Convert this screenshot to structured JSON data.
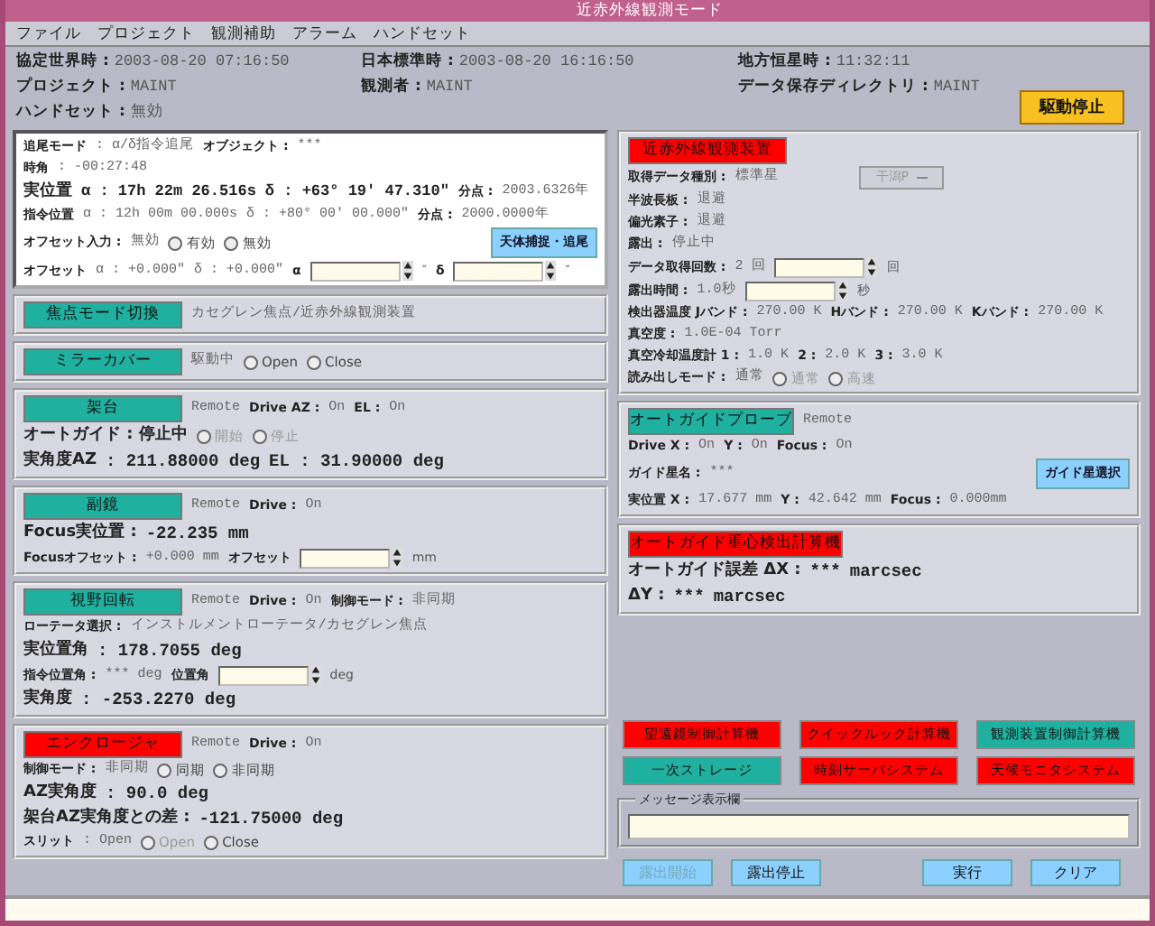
{
  "window": {
    "title": "近赤外線観測モード"
  },
  "menu": [
    "ファイル",
    "プロジェクト",
    "観測補助",
    "アラーム",
    "ハンドセット"
  ],
  "header": {
    "items": [
      {
        "label": "協定世界時 :",
        "value": "2003-08-20 07:16:50"
      },
      {
        "label": "日本標準時 :",
        "value": "2003-08-20 16:16:50"
      },
      {
        "label": "地方恒星時 :",
        "value": "11:32:11"
      },
      {
        "label": "プロジェクト :",
        "value": "MAINT"
      },
      {
        "label": "観測者 :",
        "value": "MAINT"
      },
      {
        "label": "データ保存ディレクトリ :",
        "value": "MAINT"
      },
      {
        "label": "ハンドセット :",
        "value": "無効"
      }
    ],
    "stop_button": "駆動停止"
  },
  "columns": [
    {
      "panels": [
        {
          "kind": "white",
          "rows": [
            {
              "items": [
                {
                  "kind": "label",
                  "caption": "追尾モード"
                },
                {
                  "kind": "value",
                  "text": ": α/δ指令追尾"
                },
                {
                  "kind": "label",
                  "caption": "オブジェクト :"
                },
                {
                  "kind": "value",
                  "text": "***"
                }
              ]
            },
            {
              "items": [
                {
                  "kind": "label",
                  "caption": "時角"
                },
                {
                  "kind": "value",
                  "text": ": -00:27:48"
                }
              ]
            },
            {
              "items": [
                {
                  "kind": "heading",
                  "caption": "実位置"
                },
                {
                  "kind": "reading",
                  "reading": "α : 17h 22m 26.516s"
                },
                {
                  "kind": "reading",
                  "reading": "δ : +63° 19′ 47.310″"
                },
                {
                  "kind": "label",
                  "caption": "分点 :"
                },
                {
                  "kind": "value",
                  "text": "2003.6326年"
                }
              ]
            },
            {
              "items": [
                {
                  "kind": "label",
                  "caption": "指令位置"
                },
                {
                  "kind": "value",
                  "text": "α : 12h 00m 00.000s"
                },
                {
                  "kind": "value",
                  "text": "δ : +80° 00′ 00.000″"
                },
                {
                  "kind": "label",
                  "caption": "分点 :"
                },
                {
                  "kind": "value",
                  "text": "2000.0000年"
                }
              ]
            },
            {
              "items": [
                {
                  "kind": "label",
                  "caption": "オフセット入力 :"
                },
                {
                  "kind": "value",
                  "text": "無効"
                },
                {
                  "kind": "radio",
                  "text": "有効",
                  "selected": false,
                  "disabled": false
                },
                {
                  "kind": "radio",
                  "text": "無効",
                  "selected": false,
                  "disabled": false
                },
                {
                  "kind": "button",
                  "caption": "天体捕捉・追尾",
                  "disabled": false
                }
              ]
            },
            {
              "items": [
                {
                  "kind": "label",
                  "caption": "オフセット"
                },
                {
                  "kind": "value",
                  "text": "α : +0.000″"
                },
                {
                  "kind": "value",
                  "text": "δ : +0.000″"
                },
                {
                  "kind": "label",
                  "caption": "α"
                },
                {
                  "kind": "field"
                },
                {
                  "kind": "unit",
                  "text": "″"
                },
                {
                  "kind": "label",
                  "caption": "δ"
                },
                {
                  "kind": "field"
                },
                {
                  "kind": "unit",
                  "text": "″"
                }
              ]
            }
          ]
        },
        {
          "kind": "framed",
          "rows": [
            {
              "items": [
                {
                  "kind": "tag",
                  "text": "焦点モード切換",
                  "color": "#20b0a0"
                },
                {
                  "kind": "value",
                  "text": "カセグレン焦点/近赤外線観測装置"
                }
              ]
            }
          ]
        },
        {
          "kind": "framed",
          "rows": [
            {
              "items": [
                {
                  "kind": "tag",
                  "text": "ミラーカバー",
                  "color": "#20b0a0"
                },
                {
                  "kind": "value",
                  "text": "駆動中"
                },
                {
                  "kind": "radio",
                  "text": "Open",
                  "selected": false,
                  "disabled": false
                },
                {
                  "kind": "radio",
                  "text": "Close",
                  "selected": false,
                  "disabled": false
                }
              ]
            }
          ]
        },
        {
          "kind": "framed",
          "rows": [
            {
              "items": [
                {
                  "kind": "tag",
                  "text": "架台",
                  "color": "#20b0a0"
                },
                {
                  "kind": "value",
                  "text": "Remote"
                },
                {
                  "kind": "label",
                  "caption": "Drive AZ :"
                },
                {
                  "kind": "value",
                  "text": "On"
                },
                {
                  "kind": "label",
                  "caption": "EL :"
                },
                {
                  "kind": "value",
                  "text": "On"
                }
              ]
            },
            {
              "items": [
                {
                  "kind": "heading",
                  "caption": "オートガイド : 停止中"
                },
                {
                  "kind": "radio",
                  "text": "開始",
                  "selected": false,
                  "disabled": true
                },
                {
                  "kind": "radio",
                  "text": "停止",
                  "selected": false,
                  "disabled": true
                }
              ]
            },
            {
              "items": [
                {
                  "kind": "heading",
                  "caption": "実角度AZ"
                },
                {
                  "kind": "reading",
                  "reading": ": 211.88000 deg"
                },
                {
                  "kind": "reading",
                  "reading": "EL : 31.90000 deg"
                }
              ]
            }
          ]
        },
        {
          "kind": "framed",
          "rows": [
            {
              "items": [
                {
                  "kind": "tag",
                  "text": "副鏡",
                  "color": "#20b0a0"
                },
                {
                  "kind": "value",
                  "text": "Remote"
                },
                {
                  "kind": "label",
                  "caption": "Drive :"
                },
                {
                  "kind": "value",
                  "text": "On"
                }
              ]
            },
            {
              "items": [
                {
                  "kind": "heading",
                  "caption": "Focus実位置 :"
                },
                {
                  "kind": "reading",
                  "reading": "-22.235 mm"
                }
              ]
            },
            {
              "items": [
                {
                  "kind": "label",
                  "caption": "Focusオフセット :"
                },
                {
                  "kind": "value",
                  "text": "+0.000 mm"
                },
                {
                  "kind": "label",
                  "caption": "オフセット"
                },
                {
                  "kind": "field"
                },
                {
                  "kind": "unit",
                  "text": "mm"
                }
              ]
            }
          ]
        },
        {
          "kind": "framed",
          "rows": [
            {
              "items": [
                {
                  "kind": "tag",
                  "text": "視野回転",
                  "color": "#20b0a0"
                },
                {
                  "kind": "value",
                  "text": "Remote"
                },
                {
                  "kind": "label",
                  "caption": "Drive :"
                },
                {
                  "kind": "value",
                  "text": "On"
                },
                {
                  "kind": "label",
                  "caption": "制御モード :"
                },
                {
                  "kind": "value",
                  "text": "非同期"
                }
              ]
            },
            {
              "items": [
                {
                  "kind": "label",
                  "caption": "ローテータ選択 :"
                },
                {
                  "kind": "value",
                  "text": "インストルメントローテータ/カセグレン焦点"
                }
              ]
            },
            {
              "items": [
                {
                  "kind": "heading",
                  "caption": "実位置角"
                },
                {
                  "kind": "reading",
                  "reading": ": 178.7055 deg"
                }
              ]
            },
            {
              "items": [
                {
                  "kind": "label",
                  "caption": "指令位置角 :"
                },
                {
                  "kind": "value",
                  "text": "*** deg"
                },
                {
                  "kind": "label",
                  "caption": "位置角"
                },
                {
                  "kind": "field"
                },
                {
                  "kind": "unit",
                  "text": "deg"
                }
              ]
            },
            {
              "items": [
                {
                  "kind": "heading",
                  "caption": "実角度"
                },
                {
                  "kind": "reading",
                  "reading": ": -253.2270 deg"
                }
              ]
            }
          ]
        },
        {
          "kind": "framed",
          "rows": [
            {
              "items": [
                {
                  "kind": "tag",
                  "text": "エンクロージャ",
                  "color": "#ff0000"
                },
                {
                  "kind": "value",
                  "text": "Remote"
                },
                {
                  "kind": "label",
                  "caption": "Drive :"
                },
                {
                  "kind": "value",
                  "text": "On"
                }
              ]
            },
            {
              "items": [
                {
                  "kind": "label",
                  "caption": "制御モード :"
                },
                {
                  "kind": "value",
                  "text": "非同期"
                },
                {
                  "kind": "radio",
                  "text": "同期",
                  "selected": false,
                  "disabled": false
                },
                {
                  "kind": "radio",
                  "text": "非同期",
                  "selected": false,
                  "disabled": false
                }
              ]
            },
            {
              "items": [
                {
                  "kind": "heading",
                  "caption": "AZ実角度"
                },
                {
                  "kind": "reading",
                  "reading": ": 90.0 deg"
                }
              ]
            },
            {
              "items": [
                {
                  "kind": "heading",
                  "caption": "架台AZ実角度との差 :"
                },
                {
                  "kind": "reading",
                  "reading": "-121.75000 deg"
                }
              ]
            },
            {
              "items": [
                {
                  "kind": "label",
                  "caption": "スリット"
                },
                {
                  "kind": "value",
                  "text": ": Open"
                },
                {
                  "kind": "radio",
                  "text": "Open",
                  "selected": false,
                  "disabled": true
                },
                {
                  "kind": "radio",
                  "text": "Close",
                  "selected": false,
                  "disabled": false
                }
              ]
            }
          ]
        }
      ]
    },
    {
      "panels": [
        {
          "kind": "framed",
          "rows": [
            {
              "items": [
                {
                  "kind": "tag",
                  "text": "近赤外線観測装置",
                  "color": "#ff0000"
                }
              ]
            },
            {
              "items": [
                {
                  "kind": "label",
                  "caption": "取得データ種別 :"
                },
                {
                  "kind": "value",
                  "text": "標準星"
                },
                {
                  "kind": "dropdown",
                  "text": "干潟P",
                  "disabled": true
                }
              ]
            },
            {
              "items": [
                {
                  "kind": "label",
                  "caption": "半波長板 :"
                },
                {
                  "kind": "value",
                  "text": "退避"
                }
              ]
            },
            {
              "items": [
                {
                  "kind": "label",
                  "caption": "偏光素子 :"
                },
                {
                  "kind": "value",
                  "text": "退避"
                }
              ]
            },
            {
              "items": [
                {
                  "kind": "label",
                  "caption": "露出 :"
                },
                {
                  "kind": "value",
                  "text": "停止中"
                }
              ]
            },
            {
              "items": [
                {
                  "kind": "label",
                  "caption": "データ取得回数 :"
                },
                {
                  "kind": "value",
                  "text": "2 回"
                },
                {
                  "kind": "field"
                },
                {
                  "kind": "unit",
                  "text": "回"
                }
              ]
            },
            {
              "items": [
                {
                  "kind": "label",
                  "caption": "露出時間 :"
                },
                {
                  "kind": "value",
                  "text": "1.0秒"
                },
                {
                  "kind": "field"
                },
                {
                  "kind": "unit",
                  "text": "秒"
                }
              ]
            },
            {
              "items": [
                {
                  "kind": "label",
                  "caption": "検出器温度 Jバンド :"
                },
                {
                  "kind": "value",
                  "text": "270.00 K"
                },
                {
                  "kind": "label",
                  "caption": "Hバンド :"
                },
                {
                  "kind": "value",
                  "text": "270.00 K"
                },
                {
                  "kind": "label",
                  "caption": "Kバンド :"
                },
                {
                  "kind": "value",
                  "text": "270.00 K"
                }
              ]
            },
            {
              "items": [
                {
                  "kind": "label",
                  "caption": "真空度 :"
                },
                {
                  "kind": "value",
                  "text": "1.0E-04 Torr"
                }
              ]
            },
            {
              "items": [
                {
                  "kind": "label",
                  "caption": "真空冷却温度計 1 :"
                },
                {
                  "kind": "value",
                  "text": "1.0 K"
                },
                {
                  "kind": "label",
                  "caption": "2 :"
                },
                {
                  "kind": "value",
                  "text": "2.0 K"
                },
                {
                  "kind": "label",
                  "caption": "3 :"
                },
                {
                  "kind": "value",
                  "text": "3.0 K"
                }
              ]
            },
            {
              "items": [
                {
                  "kind": "label",
                  "caption": "読み出しモード :"
                },
                {
                  "kind": "value",
                  "text": "通常"
                },
                {
                  "kind": "radio",
                  "text": "通常",
                  "selected": false,
                  "disabled": true
                },
                {
                  "kind": "radio",
                  "text": "高速",
                  "selected": false,
                  "disabled": true
                }
              ]
            }
          ]
        },
        {
          "kind": "framed",
          "rows": [
            {
              "items": [
                {
                  "kind": "tag",
                  "text": "オートガイドプローブ",
                  "color": "#20b0a0"
                },
                {
                  "kind": "value",
                  "text": "Remote"
                }
              ]
            },
            {
              "items": [
                {
                  "kind": "label",
                  "caption": "Drive X :"
                },
                {
                  "kind": "value",
                  "text": "On"
                },
                {
                  "kind": "label",
                  "caption": "Y :"
                },
                {
                  "kind": "value",
                  "text": "On"
                },
                {
                  "kind": "label",
                  "caption": "Focus :"
                },
                {
                  "kind": "value",
                  "text": "On"
                }
              ]
            },
            {
              "items": [
                {
                  "kind": "label",
                  "caption": "ガイド星名 :"
                },
                {
                  "kind": "value",
                  "text": "***"
                },
                {
                  "kind": "button",
                  "caption": "ガイド星選択",
                  "disabled": false
                }
              ]
            },
            {
              "items": [
                {
                  "kind": "label",
                  "caption": "実位置 X :"
                },
                {
                  "kind": "value",
                  "text": "17.677 mm"
                },
                {
                  "kind": "label",
                  "caption": "Y :"
                },
                {
                  "kind": "value",
                  "text": "42.642 mm"
                },
                {
                  "kind": "label",
                  "caption": "Focus :"
                },
                {
                  "kind": "value",
                  "text": "0.000mm"
                }
              ]
            }
          ]
        },
        {
          "kind": "framed",
          "rows": [
            {
              "items": [
                {
                  "kind": "tag",
                  "text": "オートガイド重心検出計算機",
                  "color": "#ff0000"
                }
              ]
            },
            {
              "items": [
                {
                  "kind": "heading",
                  "caption": "オートガイド誤差 ΔX :"
                },
                {
                  "kind": "reading",
                  "reading": "***"
                },
                {
                  "kind": "reading",
                  "reading": "marcsec"
                }
              ]
            },
            {
              "items": [
                {
                  "kind": "heading",
                  "caption": "ΔY :"
                },
                {
                  "kind": "reading",
                  "reading": "***"
                },
                {
                  "kind": "reading",
                  "reading": "marcsec"
                }
              ]
            }
          ]
        }
      ]
    }
  ],
  "systems": [
    {
      "text": "望遠鏡制御計算機",
      "color": "#ff0000"
    },
    {
      "text": "クイックルック計算機",
      "color": "#ff0000"
    },
    {
      "text": "観測装置制御計算機",
      "color": "#20b0a0"
    },
    {
      "text": "一次ストレージ",
      "color": "#20b0a0"
    },
    {
      "text": "時刻サーバシステム",
      "color": "#ff0000"
    },
    {
      "text": "天候モニタシステム",
      "color": "#ff0000"
    }
  ],
  "message": {
    "legend": "メッセージ表示欄"
  },
  "actions": [
    {
      "text": "露出開始",
      "disabled": true
    },
    {
      "text": "露出停止",
      "disabled": false
    },
    {
      "text": "実行",
      "disabled": false
    },
    {
      "text": "クリア",
      "disabled": false
    }
  ]
}
